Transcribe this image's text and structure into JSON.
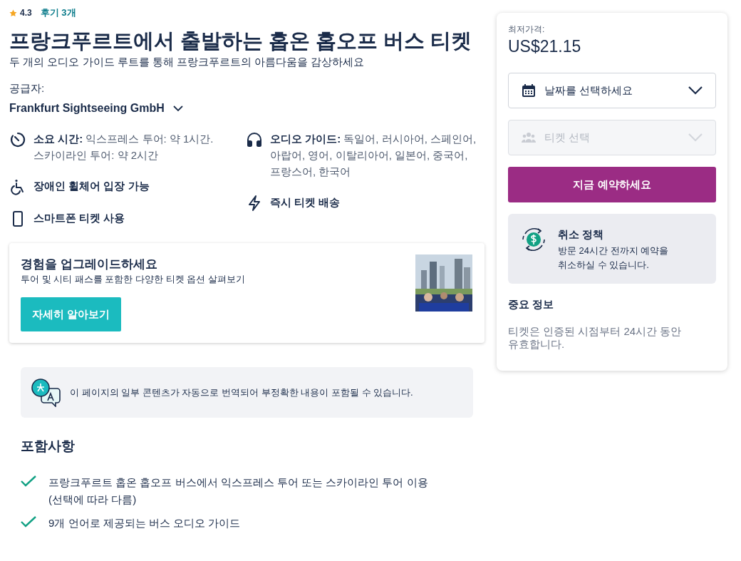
{
  "rating": {
    "score": "4.3",
    "reviews": "후기 3개"
  },
  "title": "프랑크푸르트에서 출발하는 홉온 홉오프 버스 티켓",
  "subtitle": "두 개의 오디오 가이드 루트를 통해 프랑크푸르트의 아름다움을 감상하세요",
  "supplier": {
    "label": "공급자:",
    "name": "Frankfurt Sightseeing GmbH"
  },
  "feature_columns": [
    [
      {
        "kind": "duration",
        "label": "소요 시간:",
        "text": "익스프레스 투어: 약 1시간. 스카이라인 투어: 약 2시간"
      },
      {
        "kind": "wheelchair",
        "label": "장애인 휠체어 입장 가능"
      },
      {
        "kind": "phone",
        "label": "스마트폰 티켓 사용"
      }
    ],
    [
      {
        "kind": "audio",
        "label": "오디오 가이드:",
        "text": "독일어, 러시아어, 스페인어, 아랍어, 영어, 이탈리아어, 일본어, 중국어, 프랑스어, 한국어"
      },
      {
        "kind": "instant",
        "label": "즉시 티켓 배송"
      }
    ]
  ],
  "upgrade": {
    "title": "경험을 업그레이드하세요",
    "text": "투어 및 시티 패스를 포함한 다양한 티켓 옵션 살펴보기",
    "button": "자세히 알아보기"
  },
  "translation_notice": "이 페이지의 일부 콘텐츠가 자동으로 번역되어 부정확한 내용이 포함될 수 있습니다.",
  "inclusions": {
    "title": "포함사항",
    "items": [
      "프랑크푸르트 홉온 홉오프 버스에서 익스프레스 투어 또는 스카이라인 투어 이용 (선택에 따라 다름)",
      "9개 언어로 제공되는 버스 오디오 가이드"
    ]
  },
  "booking": {
    "price_label": "최저가격:",
    "price": "US$21.15",
    "selectors": [
      {
        "kind": "date",
        "placeholder": "날짜를 선택하세요",
        "disabled": false
      },
      {
        "kind": "tickets",
        "placeholder": "티켓 선택",
        "disabled": true
      }
    ],
    "button": "지금 예약하세요",
    "cancellation": {
      "title": "취소 정책",
      "text": "방문 24시간 전까지 예약을 취소하실 수 있습니다."
    },
    "info_title": "중요 정보",
    "info_text": "티켓은 인증된 시점부터 24시간 동안 유효합니다."
  }
}
